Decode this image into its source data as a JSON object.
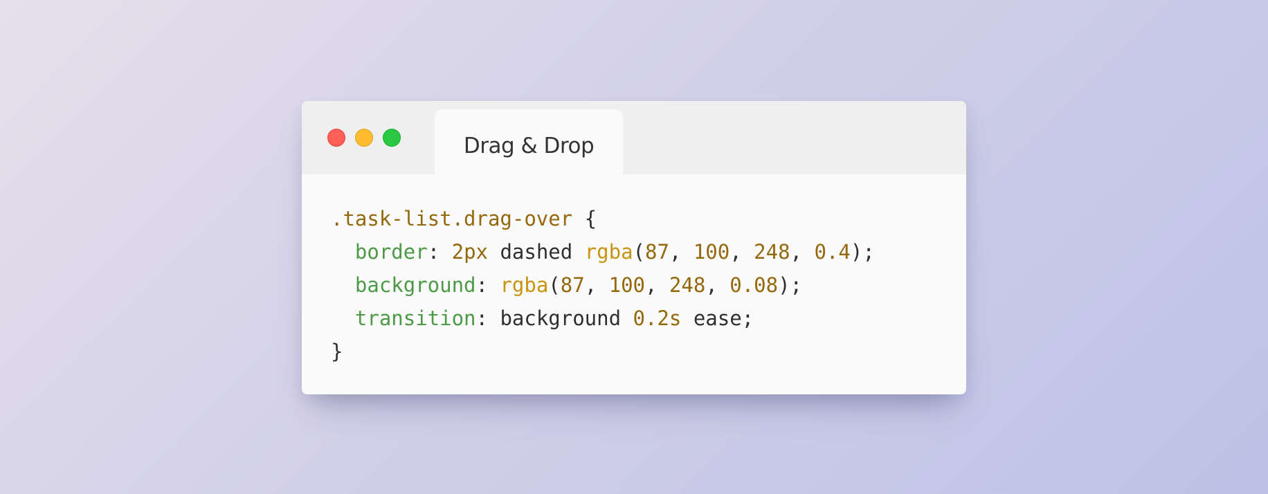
{
  "window": {
    "tab_title": "Drag & Drop"
  },
  "code": {
    "selector": ".task-list.drag-over",
    "open_brace": " {",
    "close_brace": "}",
    "lines": [
      {
        "indent": "  ",
        "property": "border",
        "colon": ": ",
        "v1": "2px",
        "v2": " dashed ",
        "fn": "rgba",
        "paren_open": "(",
        "a1": "87",
        "c1": ", ",
        "a2": "100",
        "c2": ", ",
        "a3": "248",
        "c3": ", ",
        "a4": "0.4",
        "end": ");"
      },
      {
        "indent": "  ",
        "property": "background",
        "colon": ": ",
        "fn": "rgba",
        "paren_open": "(",
        "a1": "87",
        "c1": ", ",
        "a2": "100",
        "c2": ", ",
        "a3": "248",
        "c3": ", ",
        "a4": "0.08",
        "end": ");"
      },
      {
        "indent": "  ",
        "property": "transition",
        "colon": ": ",
        "v1": "background ",
        "v2": "0.2s",
        "v3": " ease;"
      }
    ]
  },
  "colors": {
    "selector": "#94680d",
    "property": "#4c9a45",
    "function": "#c8930e",
    "number": "#94680d",
    "text": "#2f2f2f",
    "traffic_red": "#ff5f57",
    "traffic_yellow": "#febc2e",
    "traffic_green": "#28c840"
  }
}
